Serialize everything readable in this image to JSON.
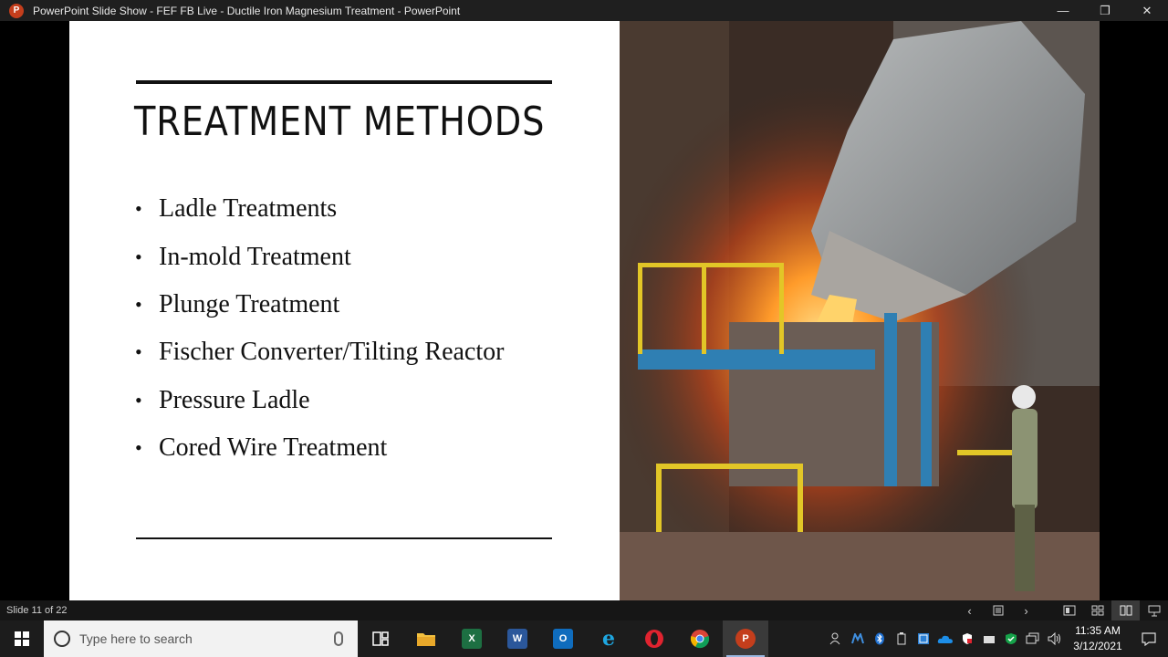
{
  "window": {
    "title": "PowerPoint Slide Show  -  FEF FB Live - Ductile Iron Magnesium Treatment - PowerPoint",
    "app_icon_letter": "P",
    "minimize": "—",
    "restore": "❐",
    "close": "✕"
  },
  "slide": {
    "title": "TREATMENT METHODS",
    "bullet": "•",
    "bullets": [
      "Ladle Treatments",
      "In-mold Treatment",
      "Plunge Treatment",
      "Fischer Converter/Tilting Reactor",
      "Pressure Ladle",
      "Cored Wire Treatment"
    ]
  },
  "statusbar": {
    "slide_info": "Slide 11 of 22",
    "prev": "‹",
    "next": "›"
  },
  "taskbar": {
    "search_placeholder": "Type here to search",
    "excel_letter": "X",
    "word_letter": "W",
    "outlook_letter": "O",
    "ie_letter": "e",
    "powerpoint_letter": "P",
    "time": "11:35 AM",
    "date": "3/12/2021"
  },
  "colors": {
    "powerpoint": "#c43e1c",
    "excel": "#1d6f42",
    "word": "#2b579a",
    "outlook": "#0f6cbd",
    "ie": "#1ea7e1",
    "opera": "#e0232f"
  }
}
